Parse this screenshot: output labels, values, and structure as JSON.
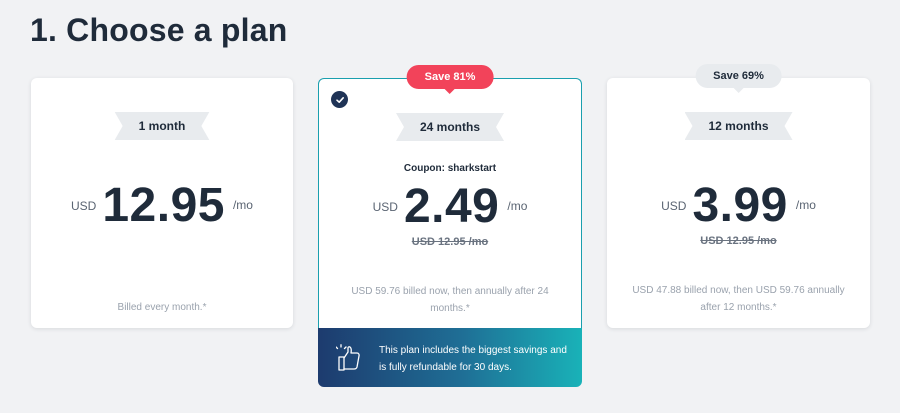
{
  "page": {
    "title": "1. Choose a plan"
  },
  "plans": [
    {
      "duration": "1 month",
      "currency": "USD",
      "price": "12.95",
      "per": "/mo",
      "billing": "Billed every month.*"
    },
    {
      "badge": "Save 81%",
      "duration": "24 months",
      "coupon": "Coupon: sharkstart",
      "currency": "USD",
      "price": "2.49",
      "per": "/mo",
      "old_price": "USD 12.95 /mo",
      "billing": "USD 59.76 billed now, then annually after 24 months.*",
      "selected": true
    },
    {
      "badge": "Save 69%",
      "duration": "12 months",
      "currency": "USD",
      "price": "3.99",
      "per": "/mo",
      "old_price": "USD 12.95 /mo",
      "billing": "USD 47.88 billed now, then USD 59.76 annually after 12 months.*"
    }
  ],
  "promo": {
    "icon": "thumbs-up-icon",
    "text": "This plan includes the biggest savings and is fully refundable for 30 days."
  },
  "colors": {
    "accent": "#1a9fae",
    "badge_red": "#f2435a",
    "check_navy": "#1f3356"
  }
}
